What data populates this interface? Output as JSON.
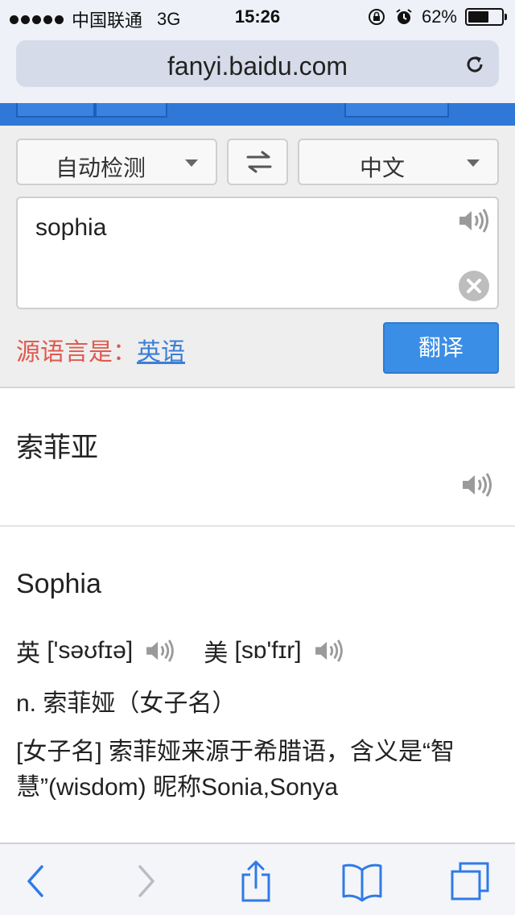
{
  "status_bar": {
    "carrier": "中国联通",
    "network": "3G",
    "time": "15:26",
    "battery": "62%",
    "battery_level": 0.62
  },
  "browser": {
    "url": "fanyi.baidu.com"
  },
  "controls": {
    "source_language": "自动检测",
    "target_language": "中文",
    "input_text": "sophia",
    "detected_prefix": "源语言是：",
    "detected_language": "英语",
    "translate_button": "翻译"
  },
  "result": {
    "translation": "索菲亚"
  },
  "dictionary": {
    "word": "Sophia",
    "uk_label": "英",
    "uk_phonetic": "['səʊfɪə]",
    "us_label": "美",
    "us_phonetic": "[sɒ'fɪr]",
    "definition_1": "n. 索菲娅（女子名）",
    "definition_2": "[女子名] 索菲娅来源于希腊语，含义是“智慧”(wisdom) 昵称Sonia,Sonya"
  },
  "colors": {
    "accent_blue": "#3078d8",
    "button_blue": "#3a8ee6",
    "source_label_red": "#e05a4f",
    "link_blue": "#3a7fd6",
    "ios_blue": "#2f7be6"
  }
}
